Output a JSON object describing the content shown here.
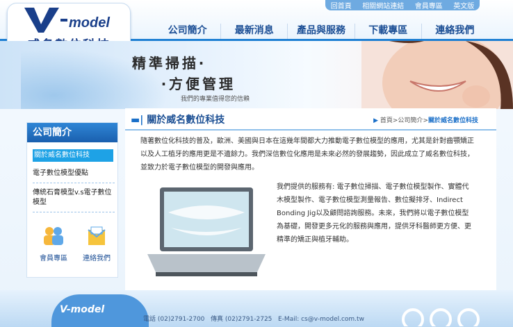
{
  "utility_nav": [
    "回首頁",
    "相關網站連結",
    "會員專區",
    "英文版"
  ],
  "logo": {
    "mark_text": "V-model",
    "company": "威名數位科技"
  },
  "main_nav": [
    "公司簡介",
    "最新消息",
    "產品與服務",
    "下載專區",
    "連絡我們"
  ],
  "banner": {
    "line1": "精準掃描‧",
    "line2": "‧方便管理",
    "tagline": "我們的專業值得您的信賴"
  },
  "sidebar": {
    "title": "公司簡介",
    "items": [
      "關於威名數位科技",
      "電子數位模型優點",
      "傳統石膏模型v.s電子數位模型"
    ],
    "icons": [
      {
        "label": "會員專區",
        "icon": "members-icon"
      },
      {
        "label": "連絡我們",
        "icon": "contact-icon"
      }
    ]
  },
  "content": {
    "title": "關於威名數位科技",
    "breadcrumb": {
      "home": "首頁",
      "section": "公司簡介",
      "current": "關於威名數位科技",
      "sep": ">"
    },
    "intro": "隨著數位化科技的普及，歐洲、美國與日本在這幾年間都大力推動電子數位模型的應用，尤其是針對齒顎矯正以及人工植牙的應用更是不遺餘力。我們深信數位化應用是未來必然的發展趨勢，因此成立了威名數位科技，並致力於電子數位模型的開發與應用。",
    "services": "我們提供的服務有: 電子數位掃描、電子數位模型製作、實體代木模型製作、電子數位模型測量報告、數位擬排牙、Indirect Bonding Jig以及顧問諮詢服務。未來，我們將以電子數位模型為基礎，開發更多元化的服務與應用，提供牙科醫師更方便、更精準的矯正與植牙輔助。"
  },
  "footer": {
    "logo": "V-model",
    "phone": "電話 (02)2791-2700",
    "fax": "傳真 (02)2791-2725",
    "email": "E-Mail: cs@v-model.com.tw"
  },
  "colors": {
    "primary": "#1d7fd3",
    "nav_text": "#1b4e95",
    "active": "#1ea2e6"
  }
}
